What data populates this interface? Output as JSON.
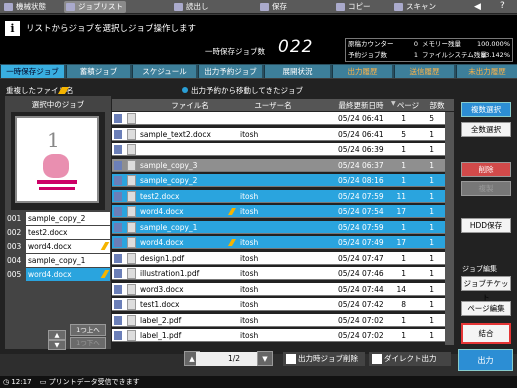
{
  "topmenu": [
    {
      "label": "機械状態",
      "active": false
    },
    {
      "label": "ジョブリスト",
      "active": true
    },
    {
      "label": "読出し",
      "active": false
    },
    {
      "label": "保存",
      "active": false
    },
    {
      "label": "コピー",
      "active": false
    },
    {
      "label": "スキャン",
      "active": false
    }
  ],
  "header": {
    "message": "リストからジョブを選択しジョブ操作します",
    "job_count_label": "一時保存ジョブ数",
    "job_count": "022",
    "status": {
      "counter_label": "原稿カウンター",
      "counter_value": "0",
      "memory_label": "メモリー残量",
      "memory_value": "100.000%",
      "capacity_label": "ファイルシステム残量",
      "capacity_value": "83.142%",
      "reserve_label": "予約ジョブ数",
      "reserve_value": "1"
    }
  },
  "tabs": [
    {
      "label": "一時保存ジョブ",
      "active": true
    },
    {
      "label": "蓄積ジョブ"
    },
    {
      "label": "スケジュール"
    },
    {
      "label": "出力予約ジョブ"
    },
    {
      "label": "展開状況"
    },
    {
      "label": "出力履歴",
      "orange": true
    },
    {
      "label": "送信履歴",
      "orange": true
    },
    {
      "label": "未出力履歴",
      "orange": true
    }
  ],
  "legend": {
    "duplicate": "重複したファイル名",
    "moved": "出力予約から移動してきたジョブ"
  },
  "selected_panel": {
    "title": "選択中のジョブ",
    "preview_number": "1",
    "items": [
      {
        "num": "001",
        "file": "sample_copy_2",
        "pen": false,
        "selected": false
      },
      {
        "num": "002",
        "file": "test2.docx",
        "pen": false,
        "selected": false
      },
      {
        "num": "003",
        "file": "word4.docx",
        "pen": true,
        "selected": false
      },
      {
        "num": "004",
        "file": "sample_copy_1",
        "pen": false,
        "selected": false
      },
      {
        "num": "005",
        "file": "word4.docx",
        "pen": true,
        "selected": true
      }
    ],
    "move_up": "1つ上へ",
    "move_down": "1つ下へ"
  },
  "table": {
    "headers": {
      "filename": "ファイル名",
      "user": "ユーザー名",
      "updated": "最終更新日時",
      "pages": "ページ",
      "copies": "部数"
    },
    "rows": [
      {
        "file": "",
        "user": "",
        "time": "05/24 06:41",
        "pages": "1",
        "copies": "5",
        "style": "white"
      },
      {
        "file": "sample_text2.docx",
        "user": "itosh",
        "time": "05/24 06:41",
        "pages": "5",
        "copies": "1",
        "style": "white"
      },
      {
        "file": "",
        "user": "",
        "time": "05/24 06:39",
        "pages": "1",
        "copies": "1",
        "style": "white"
      },
      {
        "file": "sample_copy_3",
        "user": "",
        "time": "05/24 06:37",
        "pages": "1",
        "copies": "1",
        "style": "gray"
      },
      {
        "file": "sample_copy_2",
        "user": "",
        "time": "05/24 08:16",
        "pages": "1",
        "copies": "1",
        "style": "seltop"
      },
      {
        "file": "test2.docx",
        "user": "itosh",
        "time": "05/24 07:59",
        "pages": "11",
        "copies": "1",
        "style": "sel"
      },
      {
        "file": "word4.docx",
        "user": "itosh",
        "time": "05/24 07:54",
        "pages": "17",
        "copies": "1",
        "style": "sel",
        "pen": true
      },
      {
        "file": "sample_copy_1",
        "user": "",
        "time": "05/24 07:59",
        "pages": "1",
        "copies": "1",
        "style": "sel"
      },
      {
        "file": "word4.docx",
        "user": "itosh",
        "time": "05/24 07:49",
        "pages": "17",
        "copies": "1",
        "style": "sel",
        "pen": true
      },
      {
        "file": "design1.pdf",
        "user": "itosh",
        "time": "05/24 07:47",
        "pages": "1",
        "copies": "1",
        "style": "white"
      },
      {
        "file": "illustration1.pdf",
        "user": "itosh",
        "time": "05/24 07:46",
        "pages": "1",
        "copies": "1",
        "style": "white"
      },
      {
        "file": "word3.docx",
        "user": "itosh",
        "time": "05/24 07:44",
        "pages": "14",
        "copies": "1",
        "style": "white"
      },
      {
        "file": "test1.docx",
        "user": "itosh",
        "time": "05/24 07:42",
        "pages": "8",
        "copies": "1",
        "style": "white"
      },
      {
        "file": "label_2.pdf",
        "user": "itosh",
        "time": "05/24 07:02",
        "pages": "1",
        "copies": "1",
        "style": "white"
      },
      {
        "file": "label_1.pdf",
        "user": "itosh",
        "time": "05/24 07:02",
        "pages": "1",
        "copies": "1",
        "style": "white"
      }
    ]
  },
  "right_buttons": {
    "multi_select": "複数選択",
    "select_all": "全数選択",
    "delete": "削除",
    "copy": "複製",
    "hdd_save": "HDD保存",
    "job_edit_label": "ジョブ編集",
    "job_ticket": "ジョブチケット",
    "page_edit": "ページ編集",
    "combine": "結合"
  },
  "bottom": {
    "page": "1/2",
    "delete_on_output": "出力時ジョブ削除",
    "direct_output": "ダイレクト出力",
    "output": "出力"
  },
  "statusline": {
    "time": "12:17",
    "message": "プリントデータ受信できます"
  }
}
